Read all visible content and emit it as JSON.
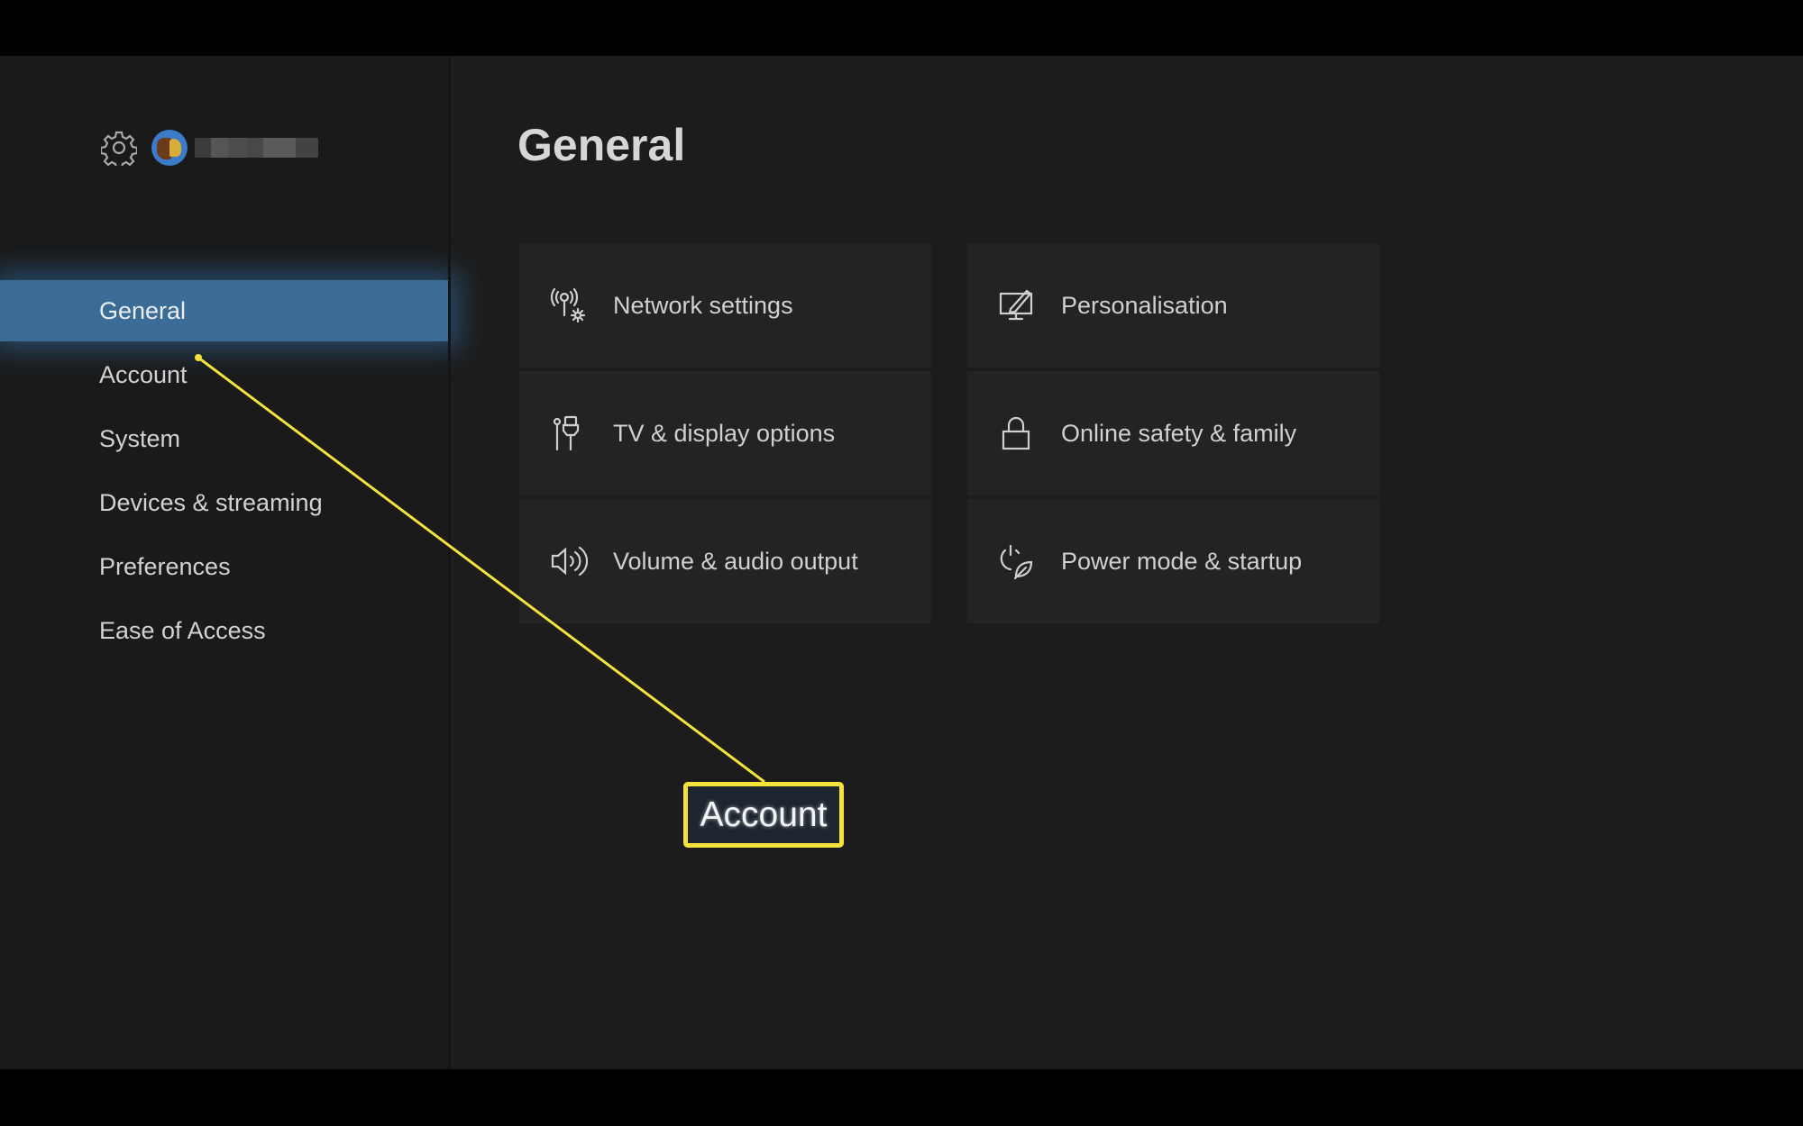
{
  "profile": {
    "settings_icon": "gear-icon",
    "avatar_colors": {
      "ring": "#3b7bc9",
      "hair": "#6a3a1a",
      "face": "#d9ad3a"
    },
    "gamertag_blurred": true
  },
  "sidebar": {
    "active_color": "#3a6c96",
    "items": [
      {
        "label": "General",
        "active": true
      },
      {
        "label": "Account",
        "active": false
      },
      {
        "label": "System",
        "active": false
      },
      {
        "label": "Devices & streaming",
        "active": false
      },
      {
        "label": "Preferences",
        "active": false
      },
      {
        "label": "Ease of Access",
        "active": false
      }
    ]
  },
  "main": {
    "title": "General",
    "tiles": [
      {
        "label": "Network settings",
        "icon": "network-settings-icon"
      },
      {
        "label": "Personalisation",
        "icon": "personalisation-icon"
      },
      {
        "label": "TV & display options",
        "icon": "tv-display-icon"
      },
      {
        "label": "Online safety & family",
        "icon": "lock-icon"
      },
      {
        "label": "Volume & audio output",
        "icon": "speaker-icon"
      },
      {
        "label": "Power mode & startup",
        "icon": "power-leaf-icon"
      }
    ]
  },
  "annotation": {
    "label": "Account",
    "color": "#f5e23a"
  }
}
